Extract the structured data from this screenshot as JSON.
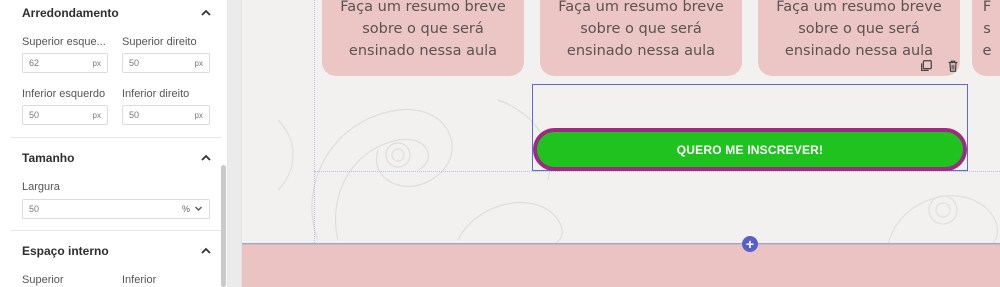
{
  "panel": {
    "rounding": {
      "title": "Arredondamento",
      "top_left": {
        "label": "Superior esquerdo",
        "label_display": "Superior esque...",
        "value": "62",
        "unit": "px"
      },
      "top_right": {
        "label": "Superior direito",
        "value": "50",
        "unit": "px"
      },
      "bottom_left": {
        "label": "Inferior esquerdo",
        "value": "50",
        "unit": "px"
      },
      "bottom_right": {
        "label": "Inferior direito",
        "value": "50",
        "unit": "px"
      }
    },
    "size": {
      "title": "Tamanho",
      "width_label": "Largura",
      "width_value": "50",
      "width_unit": "%"
    },
    "padding": {
      "title": "Espaço interno",
      "top_label": "Superior",
      "bottom_label": "Inferior"
    }
  },
  "canvas": {
    "cards": [
      {
        "text": "Faça um resumo breve sobre o que será ensinado nessa aula",
        "line1": "Faça um resumo breve",
        "line2": "sobre o que será",
        "line3": "ensinado nessa aula"
      },
      {
        "text": "Faça um resumo breve sobre o que será ensinado nessa aula",
        "line1": "Faça um resumo breve",
        "line2": "sobre o que será",
        "line3": "ensinado nessa aula"
      },
      {
        "text": "Faça um resumo breve sobre o que será ensinado nessa aula",
        "line1": "Faça um resumo breve",
        "line2": "sobre o que será",
        "line3": "ensinado nessa aula"
      },
      {
        "text": "F",
        "line1": "F",
        "line2": "s",
        "line3": "e"
      }
    ],
    "cta_button": "QUERO ME INSCREVER!",
    "add_section": "+"
  },
  "colors": {
    "cta_green": "#1fc21f",
    "cta_border": "#a02a82",
    "card_pink": "#ecc6c5",
    "selection_blue": "#5b6bd1"
  },
  "icons": [
    "chevron-up-icon",
    "chevron-down-icon",
    "duplicate-icon",
    "trash-icon",
    "plus-icon"
  ]
}
